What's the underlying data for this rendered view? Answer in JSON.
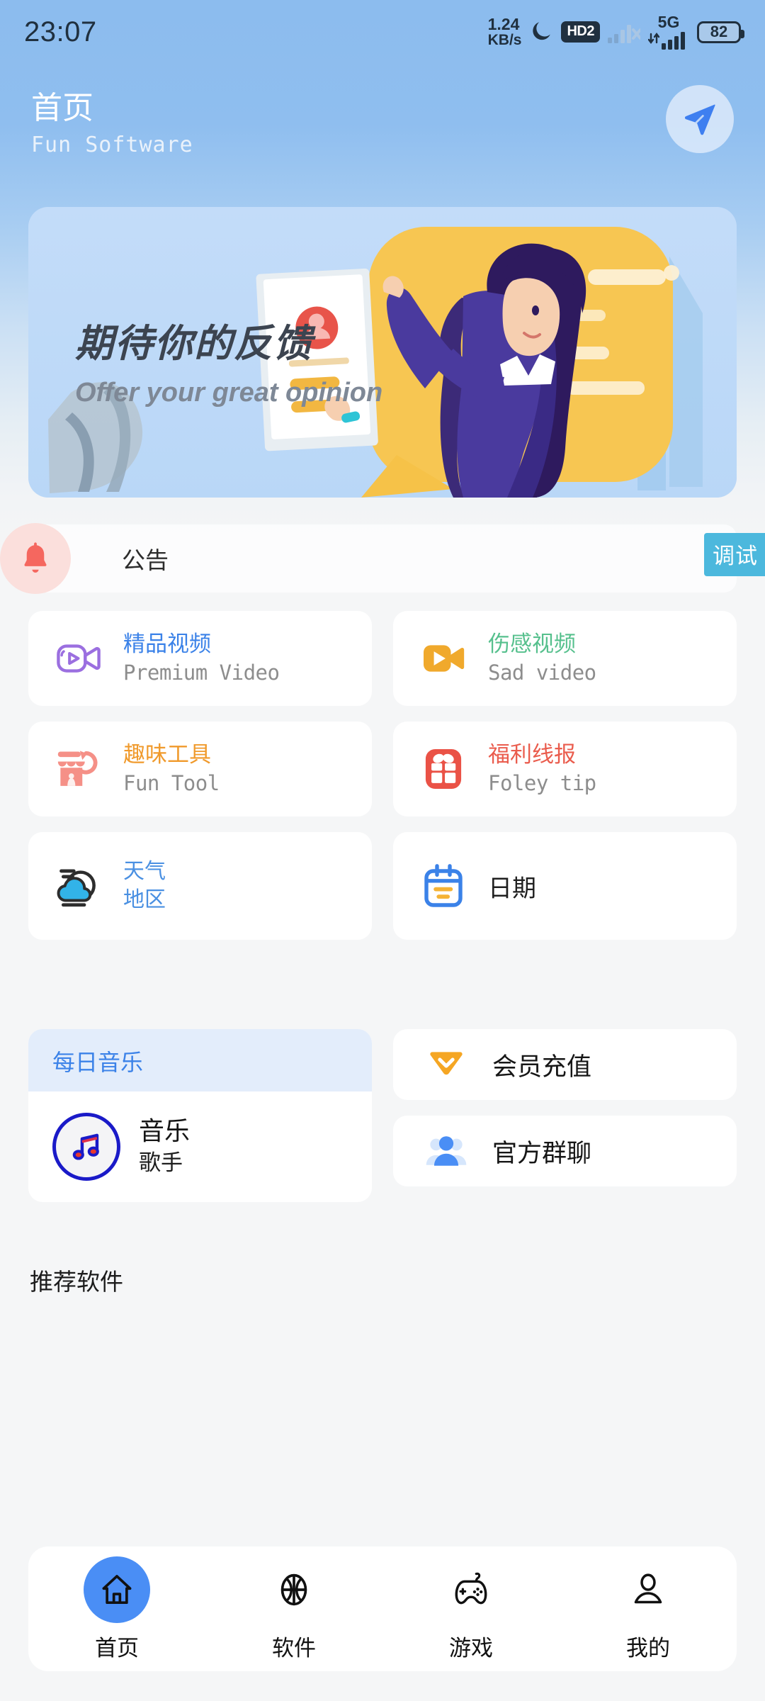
{
  "statusbar": {
    "time": "23:07",
    "net_speed_value": "1.24",
    "net_speed_unit": "KB/s",
    "dnd_icon": "moon-icon",
    "hd_badge": "HD2",
    "network_gen": "5G",
    "battery_level": "82"
  },
  "header": {
    "title": "首页",
    "subtitle": "Fun Software",
    "action_icon": "send-icon"
  },
  "banner": {
    "title": "期待你的反馈",
    "subtitle": "Offer your great opinion",
    "illustration": "woman-holding-survey-form-illustration"
  },
  "notice": {
    "icon": "bell-icon",
    "label": "公告",
    "badge": "调试"
  },
  "grid": {
    "rows": [
      [
        {
          "icon": "video-camera-outline-icon",
          "cn": "精品视频",
          "en": "Premium Video",
          "cn_color": "#3b82e8",
          "icon_color": "#9b6fe0"
        },
        {
          "icon": "video-camera-filled-icon",
          "cn": "伤感视频",
          "en": "Sad video",
          "cn_color": "#56c08d",
          "icon_color": "#f0a92c"
        }
      ],
      [
        {
          "icon": "store-refresh-icon",
          "cn": "趣味工具",
          "en": "Fun Tool",
          "cn_color": "#f09a2c",
          "icon_color": "#f59087"
        },
        {
          "icon": "gift-icon",
          "cn": "福利线报",
          "en": "Foley tip",
          "cn_color": "#ea5c4d",
          "icon_color": "#ea5246"
        }
      ]
    ],
    "weather": {
      "icon": "cloud-icon",
      "line1": "天气",
      "line2": "地区",
      "color": "#4a90e2"
    },
    "date": {
      "icon": "calendar-icon",
      "label": "日期",
      "color": "#1f1f1f"
    }
  },
  "music": {
    "section_title": "每日音乐",
    "icon": "music-note-icon",
    "name": "音乐",
    "artist": "歌手"
  },
  "quick_links": [
    {
      "icon": "diamond-icon",
      "label": "会员充值",
      "icon_color": "#f5a623"
    },
    {
      "icon": "group-people-icon",
      "label": "官方群聊",
      "icon_color": "#4a8ef5"
    }
  ],
  "recommend": {
    "title": "推荐软件"
  },
  "bottom_nav": {
    "items": [
      {
        "icon": "home-icon",
        "label": "首页",
        "active": true
      },
      {
        "icon": "basketball-icon",
        "label": "软件",
        "active": false
      },
      {
        "icon": "gamepad-icon",
        "label": "游戏",
        "active": false
      },
      {
        "icon": "person-icon",
        "label": "我的",
        "active": false
      }
    ],
    "active_color": "#4a8ef5"
  }
}
